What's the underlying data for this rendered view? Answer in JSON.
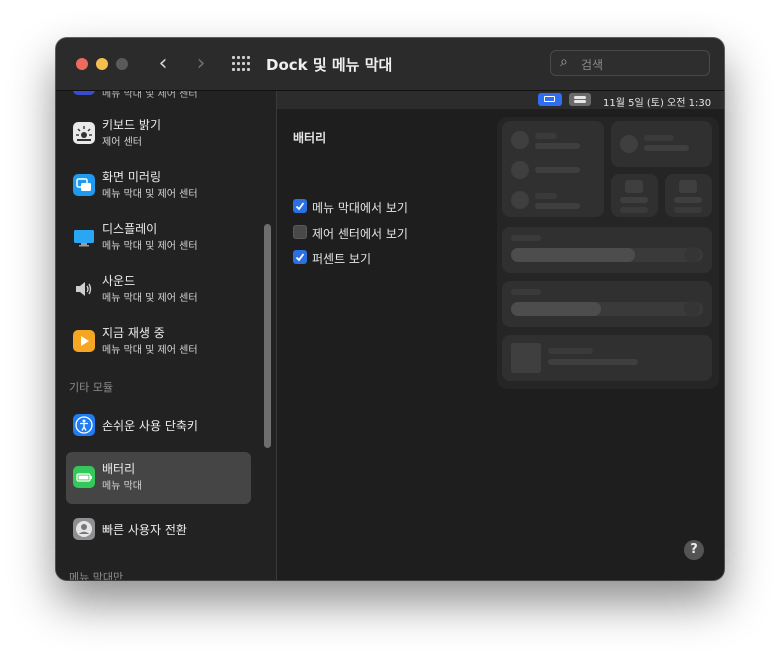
{
  "window": {
    "title": "Dock 및 메뉴 막대"
  },
  "search": {
    "placeholder": "검색"
  },
  "sidebar": {
    "partial_top": "메뉴 막대 및 제어 센터",
    "items": [
      {
        "title": "키보드 밝기",
        "subtitle": "제어 센터",
        "icon": "keyboard-brightness-icon"
      },
      {
        "title": "화면 미러링",
        "subtitle": "메뉴 막대 및 제어 센터",
        "icon": "screen-mirroring-icon"
      },
      {
        "title": "디스플레이",
        "subtitle": "메뉴 막대 및 제어 센터",
        "icon": "display-icon"
      },
      {
        "title": "사운드",
        "subtitle": "메뉴 막대 및 제어 센터",
        "icon": "sound-icon"
      },
      {
        "title": "지금 재생 중",
        "subtitle": "메뉴 막대 및 제어 센터",
        "icon": "now-playing-icon"
      }
    ],
    "section_other": "기타 모듈",
    "other_items": [
      {
        "title": "손쉬운 사용 단축키",
        "icon": "accessibility-icon"
      },
      {
        "title": "배터리",
        "subtitle": "메뉴 막대",
        "icon": "battery-icon",
        "selected": true
      },
      {
        "title": "빠른 사용자 전환",
        "icon": "user-switch-icon"
      }
    ],
    "section_menubar_only": "메뉴 막대만"
  },
  "menubar_preview": {
    "clock": "11월 5일 (토) 오전  1:30"
  },
  "battery": {
    "heading": "배터리",
    "options": [
      {
        "label": "메뉴 막대에서 보기",
        "checked": true
      },
      {
        "label": "제어 센터에서 보기",
        "checked": false
      },
      {
        "label": "퍼센트 보기",
        "checked": true
      }
    ]
  },
  "help": {
    "label": "?"
  },
  "colors": {
    "accent": "#2c6fe3",
    "selected_row": "#464546",
    "window_bg": "#1e1e1e"
  }
}
